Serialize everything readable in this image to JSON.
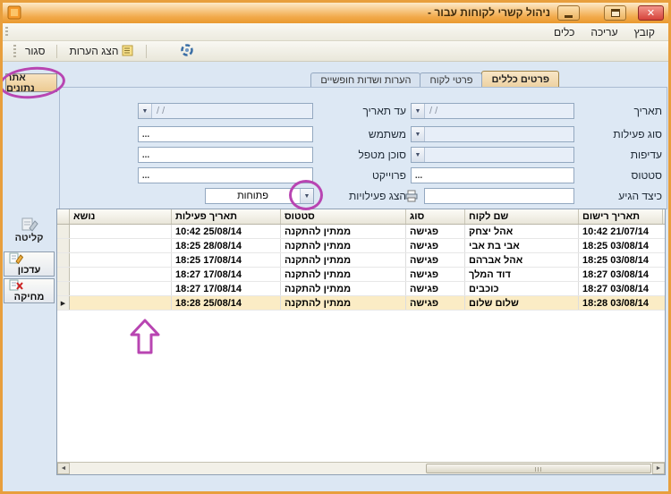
{
  "window": {
    "title": "ניהול קשרי לקוחות עבור -"
  },
  "menu": {
    "items": [
      "קובץ",
      "עריכה",
      "כלים"
    ]
  },
  "toolbar": {
    "close_button": "סגור",
    "show_notes_button": "הצג הערות"
  },
  "tabs": {
    "find_data_button": "אתר נתונים",
    "items": [
      "פרטים כללים",
      "פרטי לקוח",
      "הערות ושדות חופשיים"
    ],
    "active_tab": "פרטים כללים"
  },
  "filters": {
    "date": {
      "label": "תאריך",
      "value": "/ /"
    },
    "until_date": {
      "label": "עד תאריך",
      "value": "/ /"
    },
    "activity_type": {
      "label": "סוג פעילות",
      "value": ""
    },
    "user": {
      "label": "משתמש",
      "value": "",
      "browse": "..."
    },
    "priority": {
      "label": "עדיפות",
      "value": ""
    },
    "agent": {
      "label": "סוכן מטפל",
      "value": "",
      "browse": "..."
    },
    "status": {
      "label": "סטטוס",
      "value": "",
      "browse": "..."
    },
    "project": {
      "label": "פרוייקט",
      "value": "",
      "browse": "..."
    },
    "how_arrived": {
      "label": "כיצד הגיע",
      "value": ""
    },
    "show_activities": {
      "label": "הצג פעילויות",
      "value": "פתוחות"
    }
  },
  "sidebar": {
    "intake_button": "קליטה",
    "update_button": "עדכון",
    "delete_button": "מחיקה"
  },
  "grid": {
    "columns": [
      "נושא",
      "תאריך פעילות",
      "סטטוס",
      "סוג",
      "שם לקוח",
      "תאריך רישום"
    ],
    "rows": [
      {
        "subject": "",
        "activity_date": "25/08/14 10:42",
        "status": "ממתין להתקנה",
        "type": "פגישה",
        "customer": "אהל יצחק",
        "reg_date": "21/07/14 10:42"
      },
      {
        "subject": "",
        "activity_date": "28/08/14 18:25",
        "status": "ממתין להתקנה",
        "type": "פגישה",
        "customer": "אבי בת אבי",
        "reg_date": "03/08/14 18:25"
      },
      {
        "subject": "",
        "activity_date": "17/08/14 18:25",
        "status": "ממתין להתקנה",
        "type": "פגישה",
        "customer": "אהל אברהם",
        "reg_date": "03/08/14 18:25"
      },
      {
        "subject": "",
        "activity_date": "17/08/14 18:27",
        "status": "ממתין להתקנה",
        "type": "פגישה",
        "customer": "דוד המלך",
        "reg_date": "03/08/14 18:27"
      },
      {
        "subject": "",
        "activity_date": "17/08/14 18:27",
        "status": "ממתין להתקנה",
        "type": "פגישה",
        "customer": "כוכבים",
        "reg_date": "03/08/14 18:27"
      },
      {
        "subject": "",
        "activity_date": "25/08/14 18:28",
        "status": "ממתין להתקנה",
        "type": "פגישה",
        "customer": "שלום שלום",
        "reg_date": "03/08/14 18:28"
      }
    ]
  },
  "icons": {
    "dropdown": "▼",
    "row_indicator": "▶",
    "scroll_left": "◄",
    "scroll_right": "►",
    "close": "✕"
  },
  "colors": {
    "annotation": "#b845b2",
    "titlebar": "#f2a94a",
    "selection_row": "#fbecc5"
  }
}
